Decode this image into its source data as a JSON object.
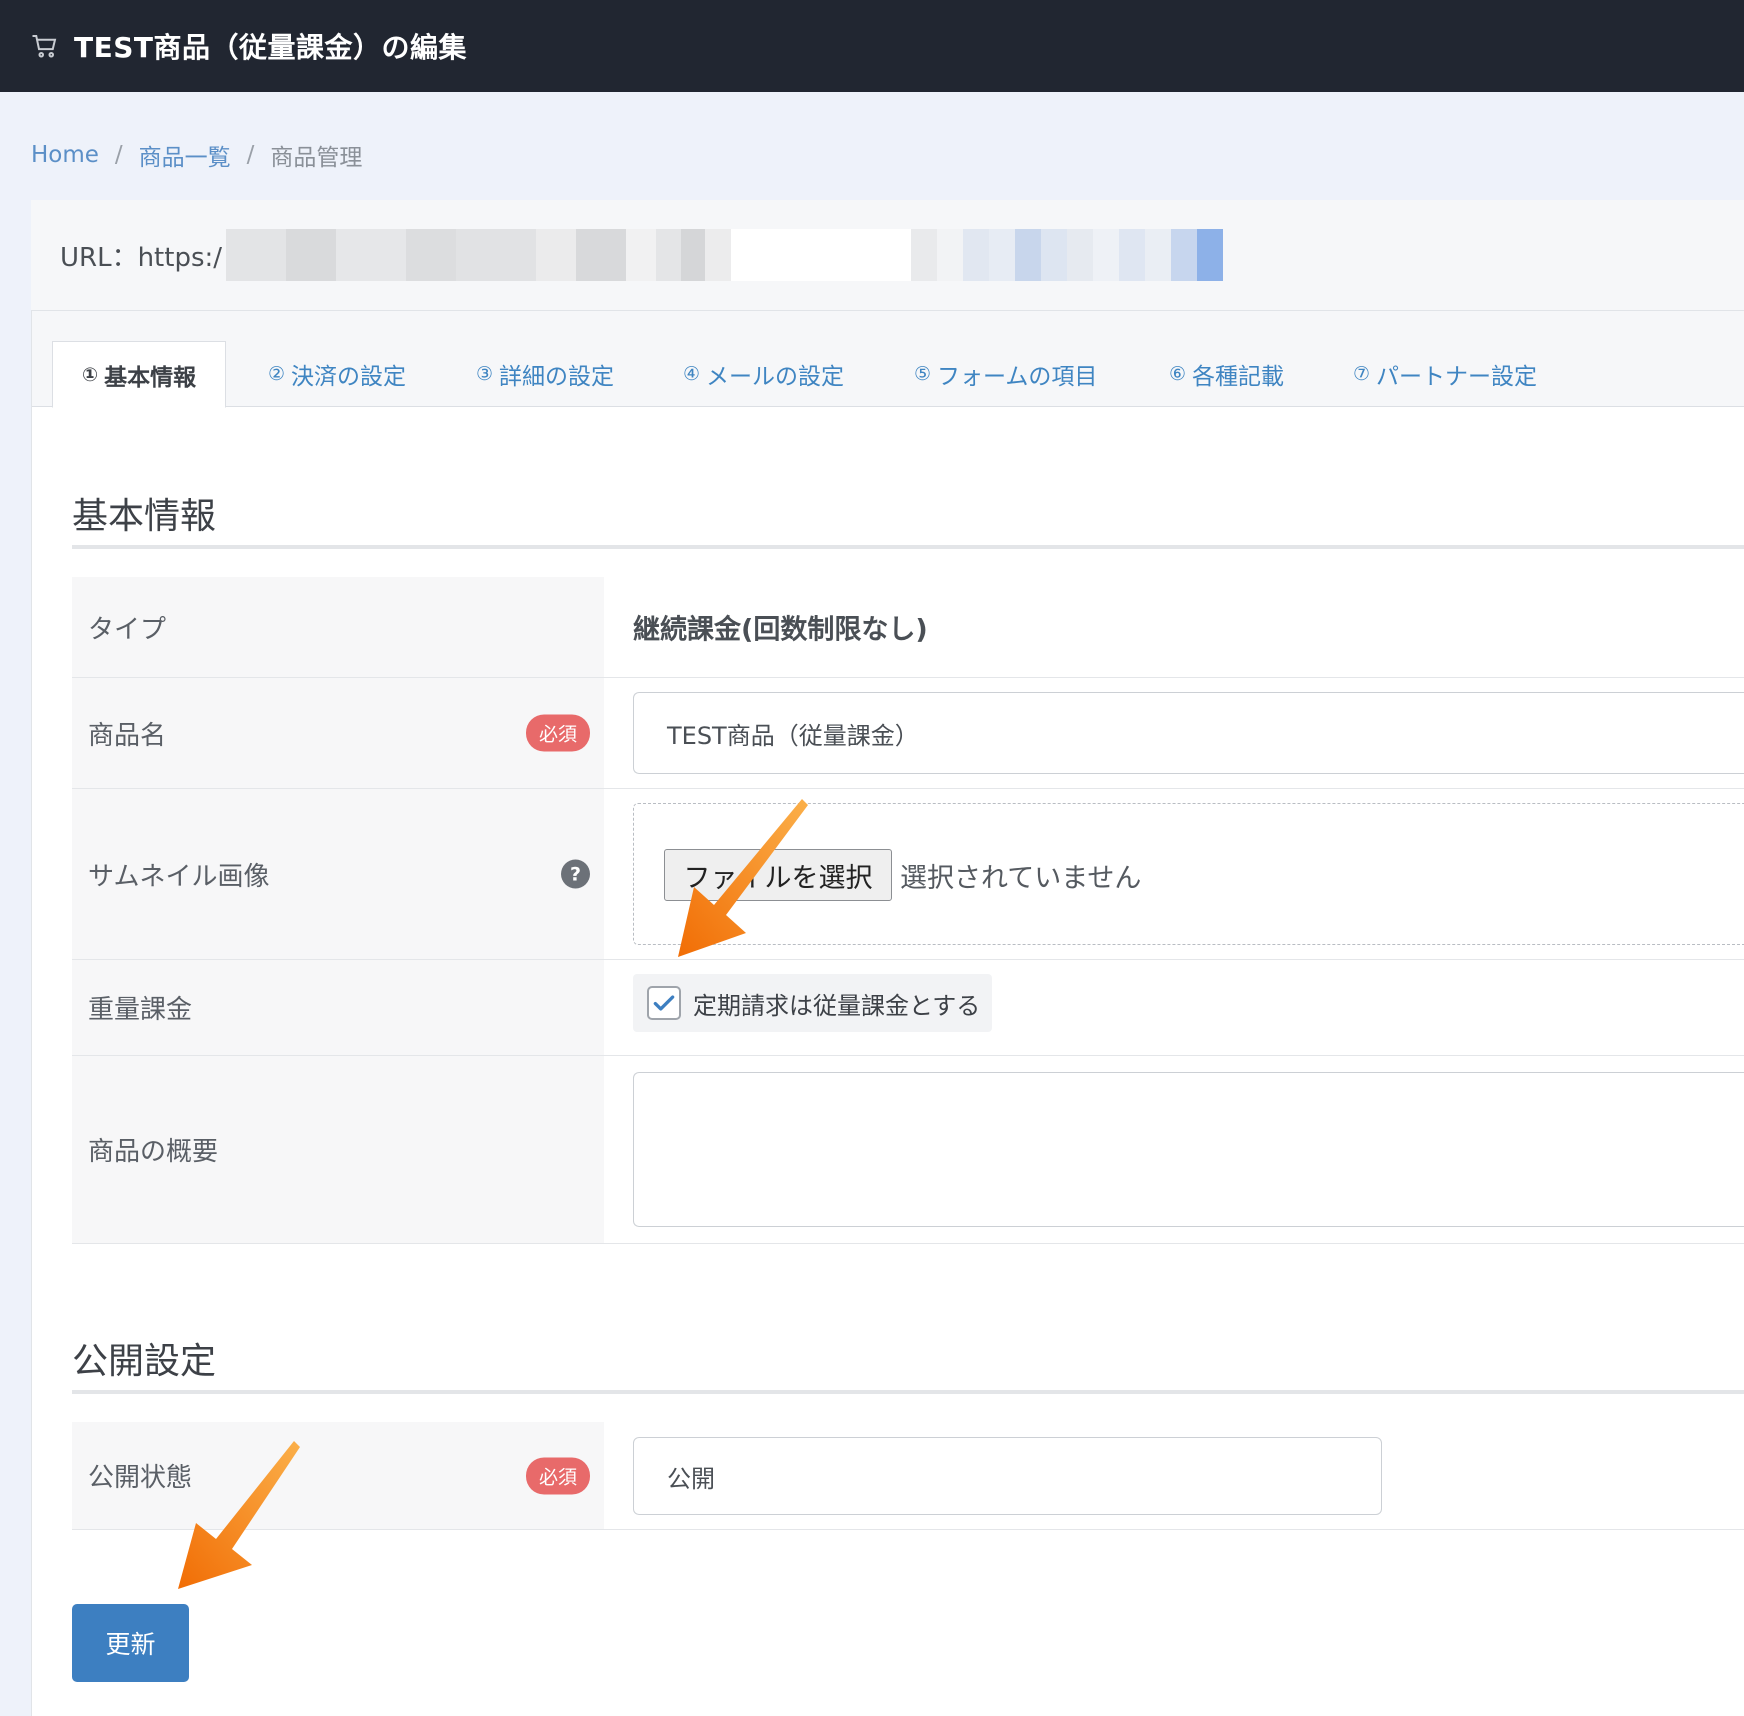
{
  "header": {
    "title": "TEST商品（従量課金）の編集",
    "icon": "cart-icon"
  },
  "breadcrumb": {
    "items": [
      "Home",
      "商品一覧",
      "商品管理"
    ],
    "separator": "/"
  },
  "url_bar": {
    "label": "URL：https:/"
  },
  "tabs": [
    {
      "num": "①",
      "label": "基本情報",
      "active": true
    },
    {
      "num": "②",
      "label": "決済の設定",
      "active": false
    },
    {
      "num": "③",
      "label": "詳細の設定",
      "active": false
    },
    {
      "num": "④",
      "label": "メールの設定",
      "active": false
    },
    {
      "num": "⑤",
      "label": "フォームの項目",
      "active": false
    },
    {
      "num": "⑥",
      "label": "各種記載",
      "active": false
    },
    {
      "num": "⑦",
      "label": "パートナー設定",
      "active": false
    }
  ],
  "basic_info": {
    "title": "基本情報",
    "type_label": "タイプ",
    "type_value": "継続課金(回数制限なし)",
    "name_label": "商品名",
    "name_value": "TEST商品（従量課金）",
    "required_badge": "必須",
    "thumbnail_label": "サムネイル画像",
    "help_icon": "?",
    "file_button": "ファイルを選択",
    "file_status": "選択されていません",
    "metered_label": "重量課金",
    "metered_checkbox_label": "定期請求は従量課金とする",
    "metered_checked": true,
    "summary_label": "商品の概要",
    "summary_value": ""
  },
  "publish": {
    "title": "公開設定",
    "status_label": "公開状態",
    "required_badge": "必須",
    "status_value": "公開"
  },
  "update_button": "更新",
  "colors": {
    "topbar": "#212631",
    "link": "#3f85c2",
    "badge": "#e86a6a",
    "primary": "#3d7fc1",
    "annotation_arrow": "#f5780f"
  }
}
